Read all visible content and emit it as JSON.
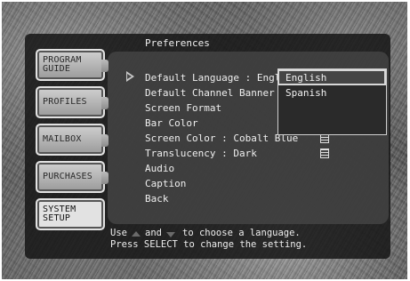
{
  "screen": {
    "title": "Preferences"
  },
  "sidebar": {
    "tabs": [
      {
        "label": "PROGRAM\nGUIDE",
        "active": false
      },
      {
        "label": "PROFILES",
        "active": false
      },
      {
        "label": "MAILBOX",
        "active": false
      },
      {
        "label": "PURCHASES",
        "active": false
      },
      {
        "label": "SYSTEM\nSETUP",
        "active": true
      }
    ]
  },
  "menu": {
    "items": [
      {
        "label": "Default Language : English",
        "has_submenu": false,
        "selected": true
      },
      {
        "label": "Default Channel Banner :",
        "has_submenu": false
      },
      {
        "label": "Screen Format",
        "has_submenu": false
      },
      {
        "label": "Bar Color",
        "has_submenu": false
      },
      {
        "label": "Screen Color : Cobalt Blue",
        "has_submenu": true
      },
      {
        "label": "Translucency : Dark",
        "has_submenu": true
      },
      {
        "label": "Audio",
        "has_submenu": false
      },
      {
        "label": "Caption",
        "has_submenu": false
      },
      {
        "label": "Back",
        "has_submenu": false
      }
    ]
  },
  "dropdown": {
    "options": [
      "English",
      "Spanish"
    ],
    "selected": "English"
  },
  "hint": {
    "line1_a": "Use",
    "line1_b": "and",
    "line1_c": "to choose a language.",
    "line2": "Press SELECT to change the setting."
  },
  "icons": {
    "cursor": "right-pointer-icon",
    "submenu": "list-icon",
    "scroll_up": "up-arrow-icon",
    "scroll_down": "down-arrow-icon"
  }
}
